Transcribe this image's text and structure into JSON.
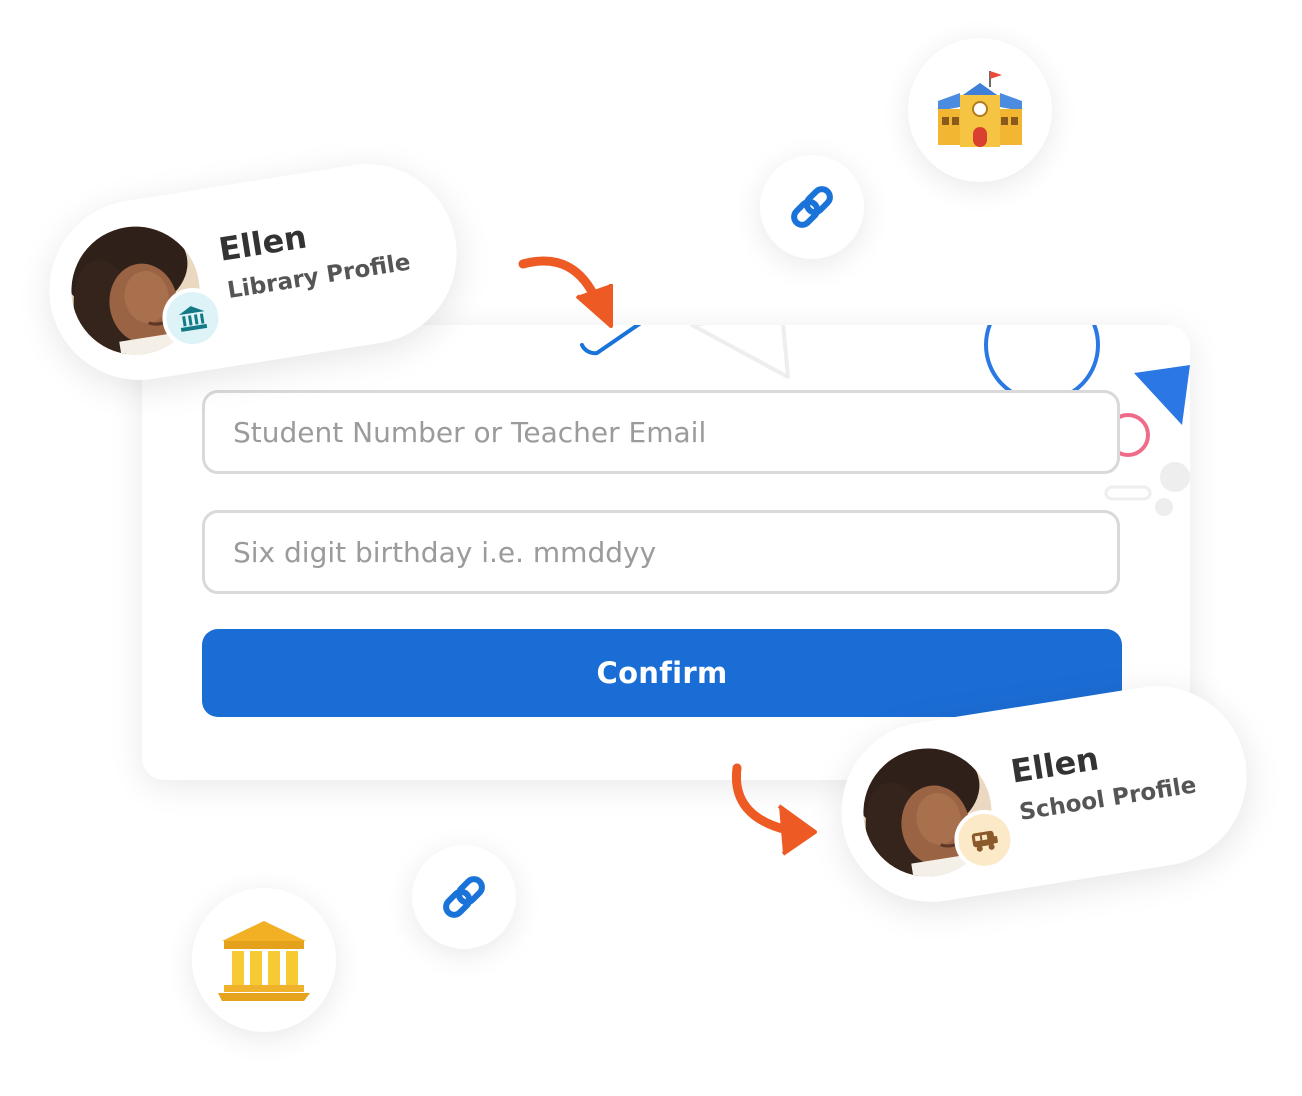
{
  "form": {
    "student_field_placeholder": "Student Number or Teacher Email",
    "birthday_field_placeholder": "Six digit birthday i.e. mmddyy",
    "confirm_label": "Confirm"
  },
  "profiles": {
    "library": {
      "name": "Ellen",
      "subtitle": "Library Profile",
      "badge_icon": "library-building-icon"
    },
    "school": {
      "name": "Ellen",
      "subtitle": "School Profile",
      "badge_icon": "school-bus-icon"
    }
  },
  "floating_icons": [
    "school-building-icon",
    "link-icon",
    "link-icon",
    "library-building-icon"
  ],
  "colors": {
    "primary_button": "#1b6dd6",
    "arrow": "#ee5a24",
    "link_icon": "#1a73d9",
    "field_border": "#d9d9d9",
    "library_badge_bg": "#def3f7",
    "school_badge_bg": "#fbe9c8"
  }
}
